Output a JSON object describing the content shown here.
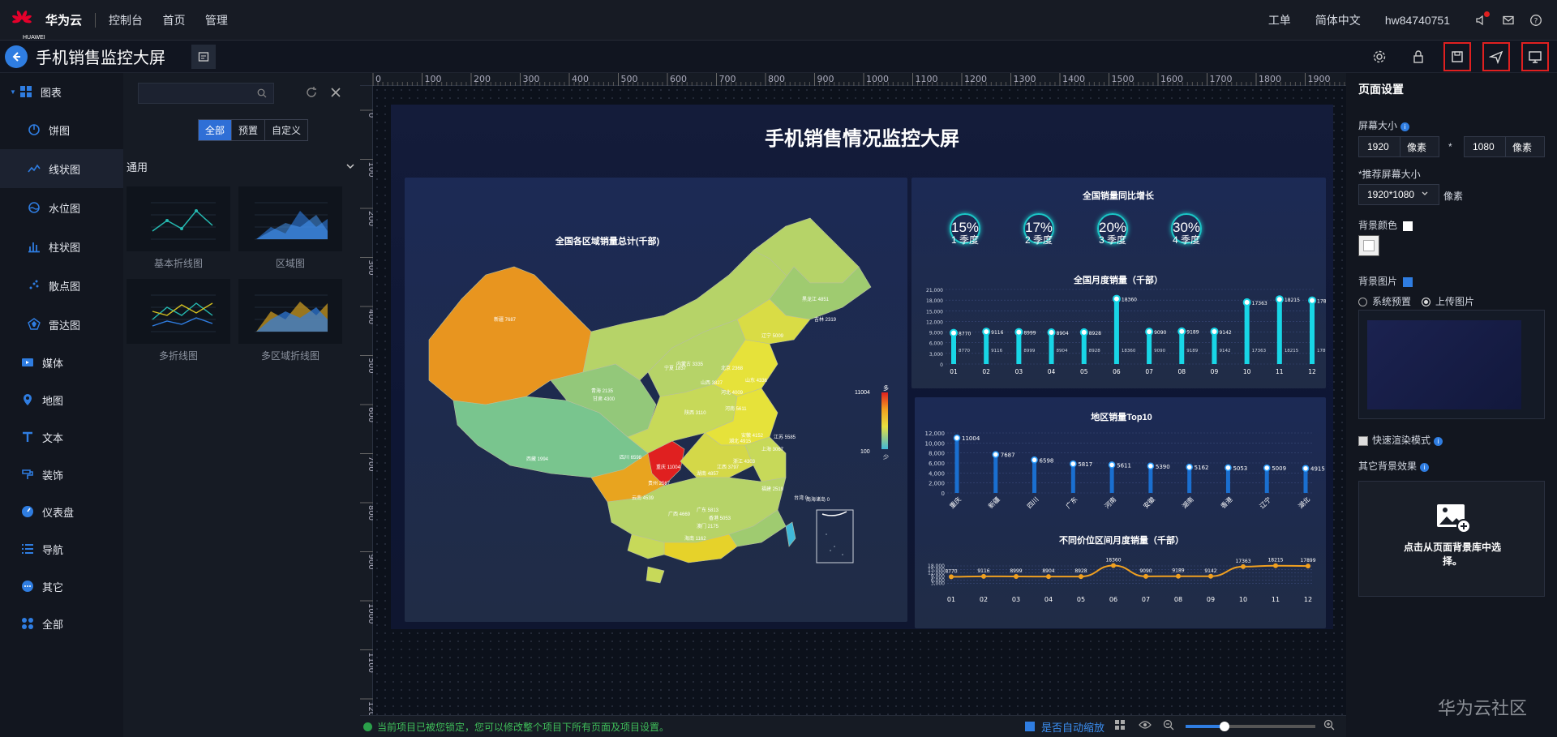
{
  "topbar": {
    "brand": "华为云",
    "logo_text": "HUAWEI",
    "nav": [
      "控制台",
      "首页",
      "管理"
    ],
    "right": [
      "工单",
      "简体中文",
      "hw84740751"
    ]
  },
  "subbar": {
    "title": "手机销售监控大屏"
  },
  "left_nav": {
    "group": "图表",
    "items": [
      {
        "label": "饼图",
        "icon": "pie-chart-icon"
      },
      {
        "label": "线状图",
        "icon": "line-chart-icon",
        "selected": true
      },
      {
        "label": "水位图",
        "icon": "water-level-icon"
      },
      {
        "label": "柱状图",
        "icon": "bar-chart-icon"
      },
      {
        "label": "散点图",
        "icon": "scatter-icon"
      },
      {
        "label": "雷达图",
        "icon": "radar-icon"
      }
    ],
    "groups": [
      {
        "label": "媒体",
        "icon": "media-icon"
      },
      {
        "label": "地图",
        "icon": "map-pin-icon"
      },
      {
        "label": "文本",
        "icon": "text-icon"
      },
      {
        "label": "装饰",
        "icon": "decoration-icon"
      },
      {
        "label": "仪表盘",
        "icon": "dashboard-icon"
      },
      {
        "label": "导航",
        "icon": "nav-list-icon"
      },
      {
        "label": "其它",
        "icon": "more-icon"
      },
      {
        "label": "全部",
        "icon": "all-icon"
      }
    ]
  },
  "component_panel": {
    "search_placeholder": "",
    "tabs": [
      "全部",
      "预置",
      "自定义"
    ],
    "section": "通用",
    "thumbs": [
      "基本折线图",
      "区域图",
      "多折线图",
      "多区域折线图"
    ]
  },
  "ruler": {
    "h": [
      "0",
      "100",
      "200",
      "300",
      "400",
      "500",
      "600",
      "700",
      "800",
      "900",
      "1000",
      "1100",
      "1200",
      "1300",
      "1400",
      "1500",
      "1600",
      "1700",
      "1800",
      "1900"
    ],
    "v": [
      "0",
      "100",
      "200",
      "300",
      "400",
      "500",
      "600",
      "700",
      "800",
      "900",
      "1000",
      "1100",
      "1200"
    ]
  },
  "screen": {
    "title": "手机销售情况监控大屏",
    "map": {
      "title": "全国各区域销量总计(千部)",
      "legend_high": "多",
      "legend_low": "少",
      "legend_max": "11004",
      "legend_min": "100",
      "regions": [
        {
          "name": "新疆 7687"
        },
        {
          "name": "西藏 1994"
        },
        {
          "name": "青海 2135"
        },
        {
          "name": "甘肃 4300"
        },
        {
          "name": "内蒙古 3335"
        },
        {
          "name": "黑龙江 4851"
        },
        {
          "name": "吉林 2319"
        },
        {
          "name": "辽宁 5009"
        },
        {
          "name": "宁夏 1837"
        },
        {
          "name": "山西 3827"
        },
        {
          "name": "河北 4009"
        },
        {
          "name": "山东 4336"
        },
        {
          "name": "北京 2368"
        },
        {
          "name": "陕西 3110"
        },
        {
          "name": "河南 5611"
        },
        {
          "name": "四川 6598"
        },
        {
          "name": "重庆 11004"
        },
        {
          "name": "湖北 4915"
        },
        {
          "name": "安徽 4152"
        },
        {
          "name": "江苏 5585"
        },
        {
          "name": "上海 3067"
        },
        {
          "name": "浙江 4303"
        },
        {
          "name": "湖南 4857"
        },
        {
          "name": "江西 3797"
        },
        {
          "name": "贵州 2567"
        },
        {
          "name": "云南 4539"
        },
        {
          "name": "广西 4669"
        },
        {
          "name": "广东 5813"
        },
        {
          "name": "福建 2519"
        },
        {
          "name": "台湾 0"
        },
        {
          "name": "澳门 2175"
        },
        {
          "name": "香港 5053"
        },
        {
          "name": "海南 1162"
        },
        {
          "name": "南海诸岛 0"
        }
      ]
    },
    "growth": {
      "title": "全国销量同比增长",
      "items": [
        {
          "pct": "15%",
          "label": "1 季度"
        },
        {
          "pct": "17%",
          "label": "2 季度"
        },
        {
          "pct": "20%",
          "label": "3 季度"
        },
        {
          "pct": "30%",
          "label": "4 季度"
        }
      ]
    },
    "monthly_title": "全国月度销量（千部）",
    "top10_title": "地区销量Top10",
    "price_title": "不同价位区间月度销量（千部）"
  },
  "chart_data": [
    {
      "type": "bar",
      "title": "全国月度销量（千部）",
      "categories": [
        "01",
        "02",
        "03",
        "04",
        "05",
        "06",
        "07",
        "08",
        "09",
        "10",
        "11",
        "12"
      ],
      "values": [
        8770,
        9116,
        8999,
        8904,
        8928,
        18360,
        9090,
        9189,
        9142,
        17363,
        18215,
        17899
      ],
      "ylim": [
        0,
        21000
      ],
      "yticks": [
        "0",
        "3,000",
        "6,000",
        "9,000",
        "12,000",
        "15,000",
        "18,000",
        "21,000"
      ]
    },
    {
      "type": "bar",
      "title": "地区销量Top10",
      "categories": [
        "重庆",
        "新疆",
        "四川",
        "广东",
        "河南",
        "安徽",
        "湖南",
        "香港",
        "辽宁",
        "湖北"
      ],
      "values": [
        11004,
        7687,
        6598,
        5817,
        5611,
        5390,
        5162,
        5053,
        5009,
        4915
      ],
      "ylim": [
        0,
        12000
      ],
      "yticks": [
        "0",
        "2,000",
        "4,000",
        "6,000",
        "8,000",
        "10,000",
        "12,000"
      ]
    },
    {
      "type": "line",
      "title": "不同价位区间月度销量（千部）",
      "categories": [
        "01",
        "02",
        "03",
        "04",
        "05",
        "06",
        "07",
        "08",
        "09",
        "10",
        "11",
        "12"
      ],
      "values": [
        8770,
        9116,
        8999,
        8904,
        8928,
        18360,
        9090,
        9189,
        9142,
        17363,
        18215,
        17899
      ],
      "ylim": [
        0,
        18000
      ],
      "yticks": [
        "3,000",
        "6,000",
        "9,000",
        "12,000",
        "15,000",
        "18,000"
      ]
    }
  ],
  "statusbar": {
    "message": "当前项目已被您锁定，您可以修改整个项目下所有页面及项目设置。",
    "auto_zoom": "是否自动缩放",
    "zoom": 0.3
  },
  "right_panel": {
    "title": "页面设置",
    "screen_size_label": "屏幕大小",
    "width": "1920",
    "height": "1080",
    "unit": "像素",
    "times": "*",
    "recommend_label": "*推荐屏幕大小",
    "recommend_value": "1920*1080",
    "bg_color_label": "背景颜色",
    "bg_image_label": "背景图片",
    "radio_preset": "系统预置",
    "radio_upload": "上传图片",
    "fast_render": "快速渲染模式",
    "other_bg": "其它背景效果",
    "click_select": "点击从页面背景库中选择。"
  },
  "watermark": "华为云社区",
  "colors": {
    "accent": "#2f7de1",
    "highlight_border": "#e02020",
    "bar_cyan": "#18d6e6",
    "line_orange": "#f0a020"
  }
}
